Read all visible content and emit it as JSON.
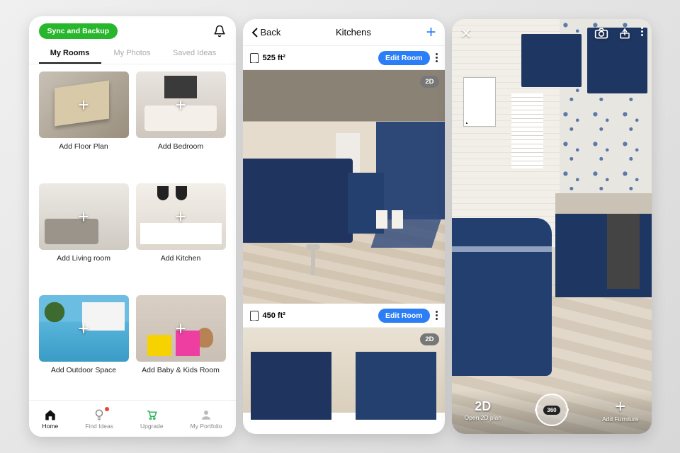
{
  "phone1": {
    "sync_label": "Sync and Backup",
    "tabs": [
      "My Rooms",
      "My Photos",
      "Saved Ideas"
    ],
    "active_tab": 0,
    "rooms": [
      {
        "label": "Add Floor Plan"
      },
      {
        "label": "Add Bedroom"
      },
      {
        "label": "Add Living room"
      },
      {
        "label": "Add Kitchen"
      },
      {
        "label": "Add Outdoor Space"
      },
      {
        "label": "Add Baby & Kids Room"
      }
    ],
    "nav": [
      {
        "label": "Home"
      },
      {
        "label": "Find Ideas"
      },
      {
        "label": "Upgrade"
      },
      {
        "label": "My Portfolio"
      }
    ]
  },
  "phone2": {
    "back_label": "Back",
    "title": "Kitchens",
    "rows": [
      {
        "area": "525 ft²",
        "edit": "Edit Room",
        "badge": "2D"
      },
      {
        "area": "450 ft²",
        "edit": "Edit Room",
        "badge": "2D"
      }
    ]
  },
  "phone3": {
    "left_action": {
      "big": "2D",
      "sub": "Open 2D plan"
    },
    "center_label": "360",
    "right_action": {
      "sub": "Add Furniture"
    }
  },
  "colors": {
    "accent_green": "#28b62c",
    "accent_blue": "#2b7ef5",
    "cabinet_navy": "#1f3560"
  }
}
